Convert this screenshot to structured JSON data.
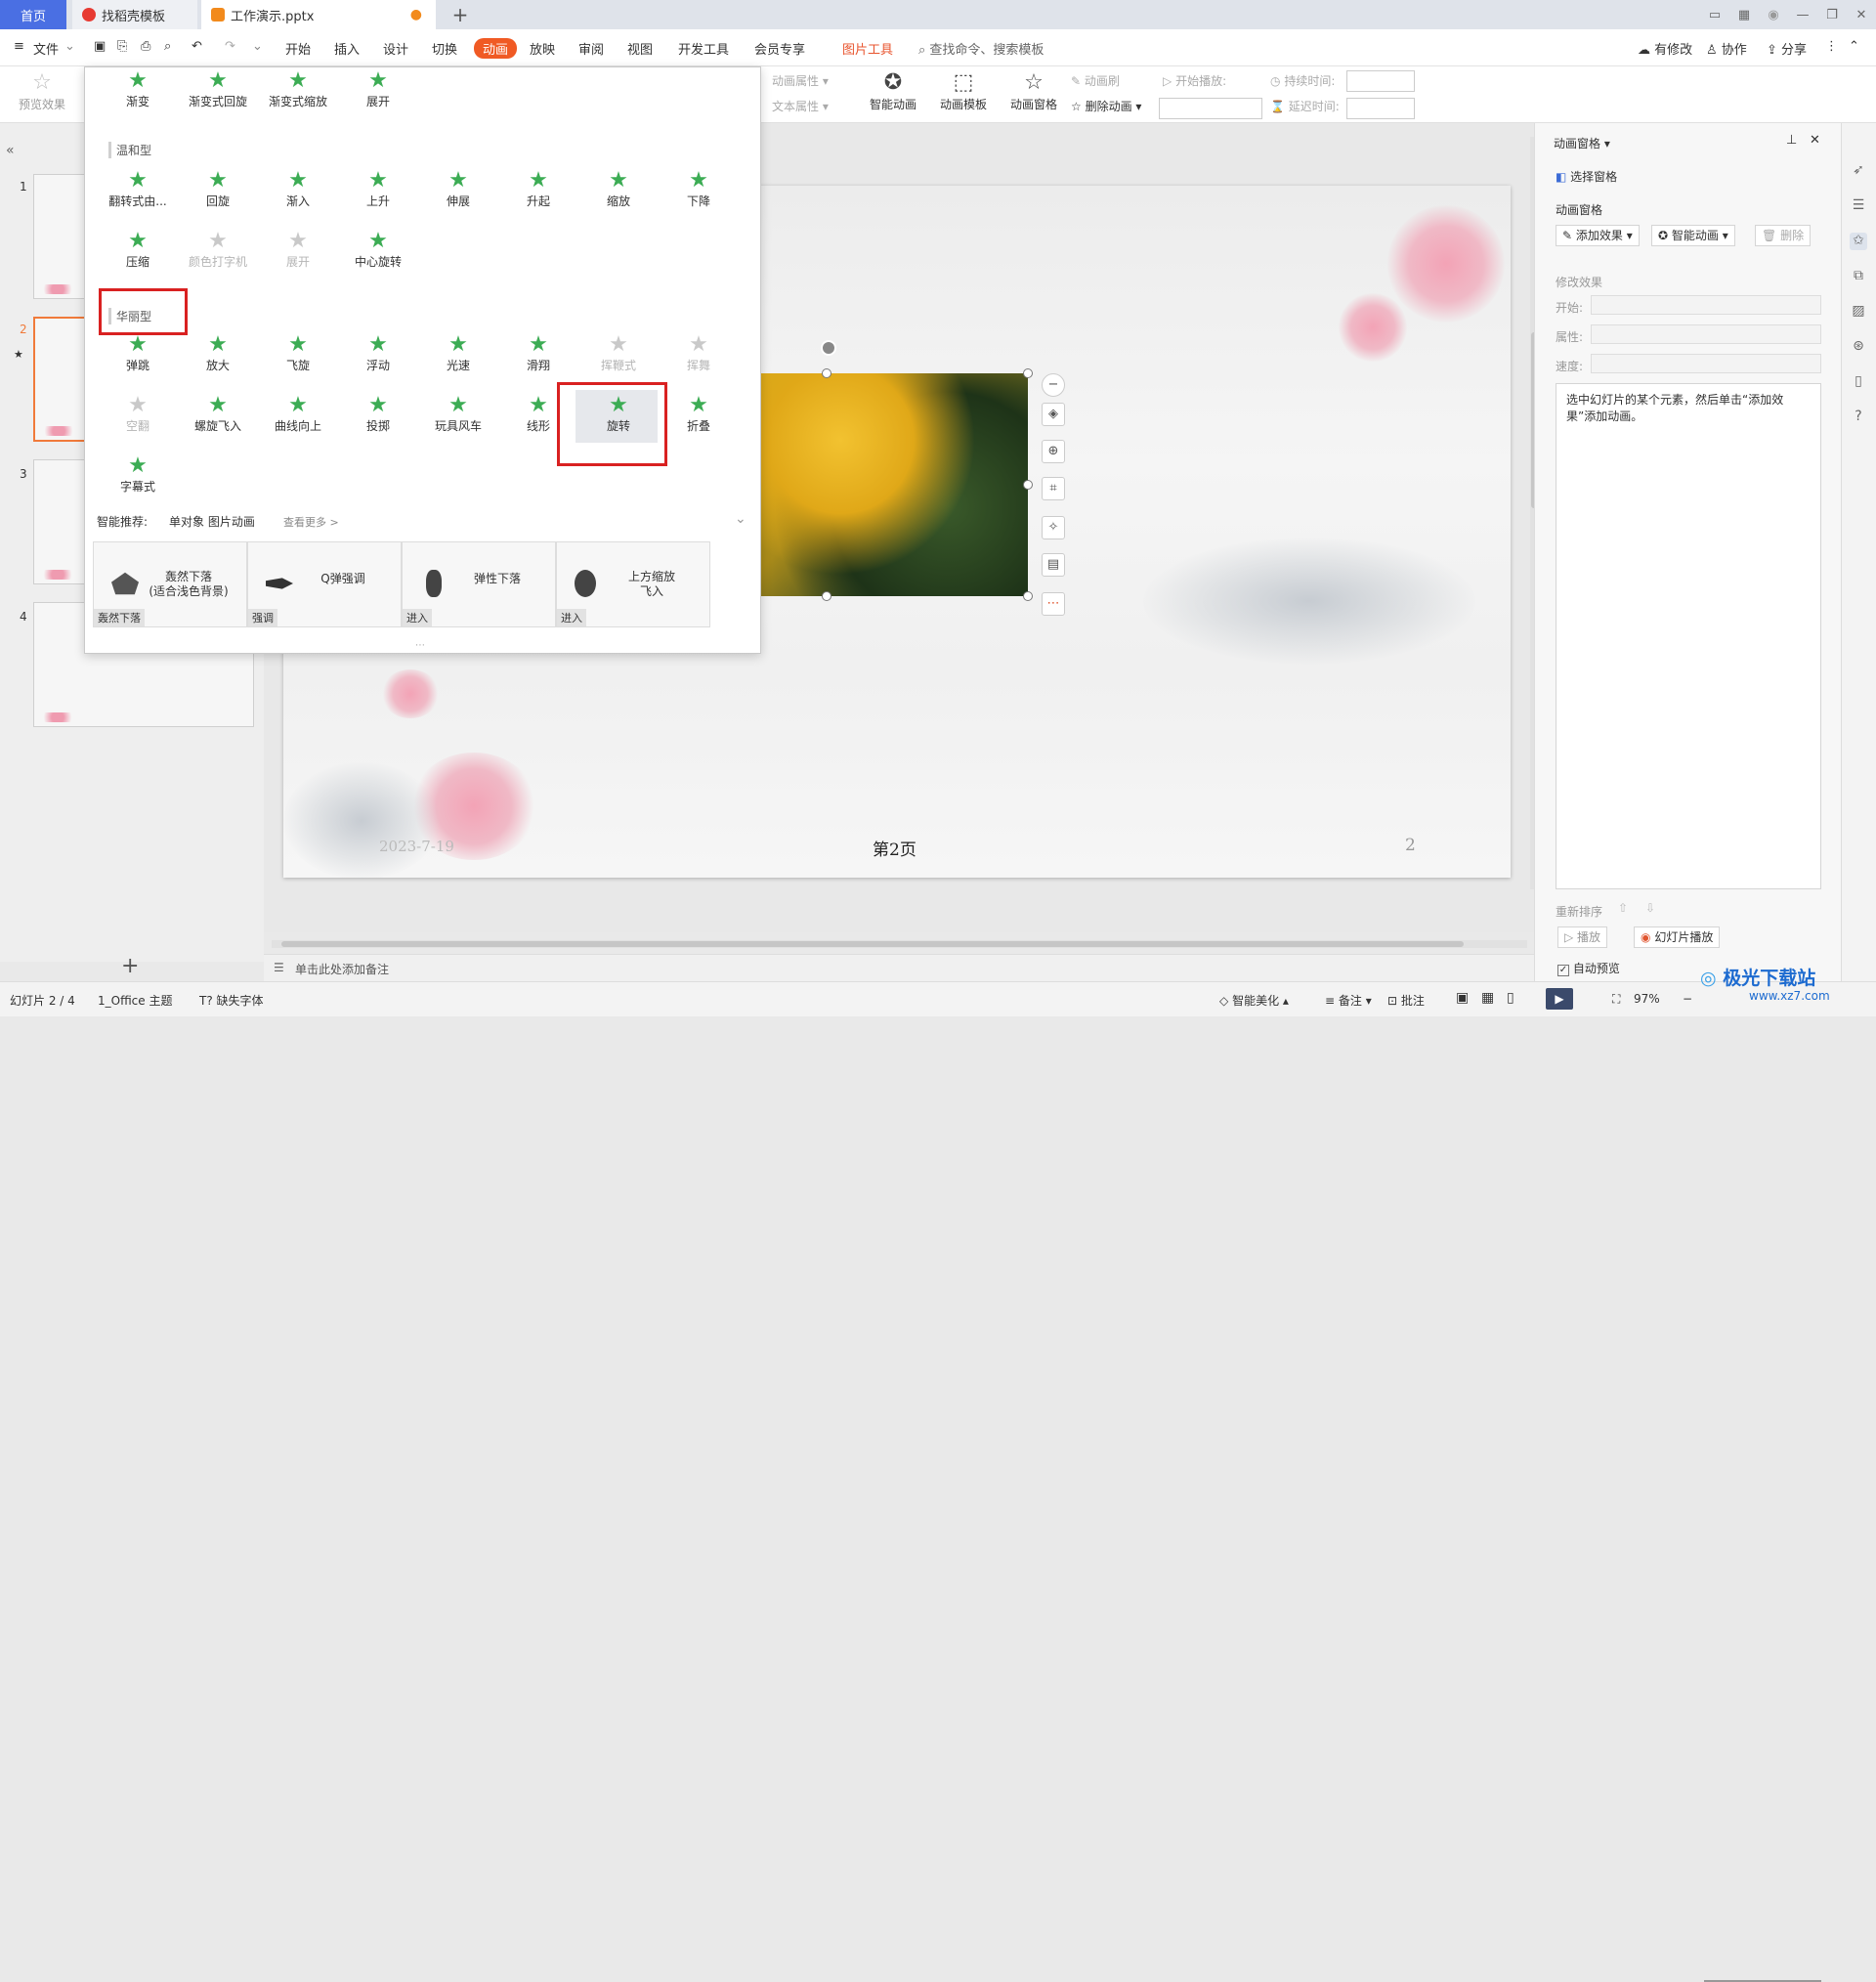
{
  "titlebar": {
    "tab_home": "首页",
    "tab_template": "找稻壳模板",
    "tab_document": "工作演示.pptx"
  },
  "menubar": {
    "file": "文件",
    "tabs": [
      "开始",
      "插入",
      "设计",
      "切换",
      "动画",
      "放映",
      "审阅",
      "视图",
      "开发工具",
      "会员专享",
      "图片工具"
    ],
    "search": "查找命令、搜索模板",
    "modified": "有修改",
    "collab": "协作",
    "share": "分享"
  },
  "ribbon": {
    "preview": "预览效果",
    "anim_props": "动画属性",
    "text_props": "文本属性",
    "smart_anim": "智能动画",
    "anim_template": "动画模板",
    "anim_pane": "动画窗格",
    "delete_anim": "删除动画",
    "anim_brush": "动画刷",
    "start_play": "开始播放:",
    "duration": "持续时间:",
    "delay": "延迟时间:"
  },
  "dropdown": {
    "top_row": [
      "渐变",
      "渐变式回旋",
      "渐变式缩放",
      "展开"
    ],
    "section_mild": "温和型",
    "mild_row1": [
      "翻转式由...",
      "回旋",
      "渐入",
      "上升",
      "伸展",
      "升起",
      "缩放",
      "下降"
    ],
    "mild_row2": [
      "压缩",
      "颜色打字机",
      "展开",
      "中心旋转"
    ],
    "section_fancy": "华丽型",
    "fancy_row1": [
      "弹跳",
      "放大",
      "飞旋",
      "浮动",
      "光速",
      "滑翔",
      "挥鞭式",
      "挥舞"
    ],
    "fancy_row2": [
      "空翻",
      "螺旋飞入",
      "曲线向上",
      "投掷",
      "玩具风车",
      "线形",
      "旋转",
      "折叠"
    ],
    "fancy_row3": [
      "字幕式"
    ],
    "smart_recommend": "智能推荐:",
    "single_obj": "单对象 图片动画",
    "see_more": "查看更多 >",
    "cards": [
      {
        "title": "轰然下落\n(适合浅色背景)",
        "tag": "轰然下落"
      },
      {
        "title": "Q弹强调",
        "tag": "强调"
      },
      {
        "title": "弹性下落",
        "tag": "进入"
      },
      {
        "title": "上方缩放\n飞入",
        "tag": "进入"
      }
    ]
  },
  "slides": {
    "numbers": [
      "1",
      "2",
      "3",
      "4"
    ]
  },
  "slide": {
    "date": "2023-7-19",
    "page_label": "第2页",
    "page_number": "2"
  },
  "notes": {
    "placeholder": "单击此处添加备注"
  },
  "statusbar": {
    "slide_count": "幻灯片 2 / 4",
    "theme": "1_Office 主题",
    "missing_font": "缺失字体",
    "beautify": "智能美化",
    "notes": "备注",
    "comment": "批注",
    "zoom": "97%"
  },
  "rightpane": {
    "title": "动画窗格",
    "select_pane": "选择窗格",
    "pane_label": "动画窗格",
    "add_effect": "添加效果",
    "smart_anim": "智能动画",
    "delete": "删除",
    "modify": "修改效果",
    "start": "开始:",
    "property": "属性:",
    "speed": "速度:",
    "hint": "选中幻灯片的某个元素，然后单击“添加效果”添加动画。",
    "reorder": "重新排序",
    "play": "播放",
    "slideshow": "幻灯片播放",
    "auto_preview": "自动预览"
  },
  "watermark": {
    "text": "极光下载站",
    "url": "www.xz7.com"
  },
  "colors": {
    "accent": "#f05a24",
    "home_tab": "#4a6fe3",
    "highlight": "#d92121",
    "star": "#3cac54"
  }
}
